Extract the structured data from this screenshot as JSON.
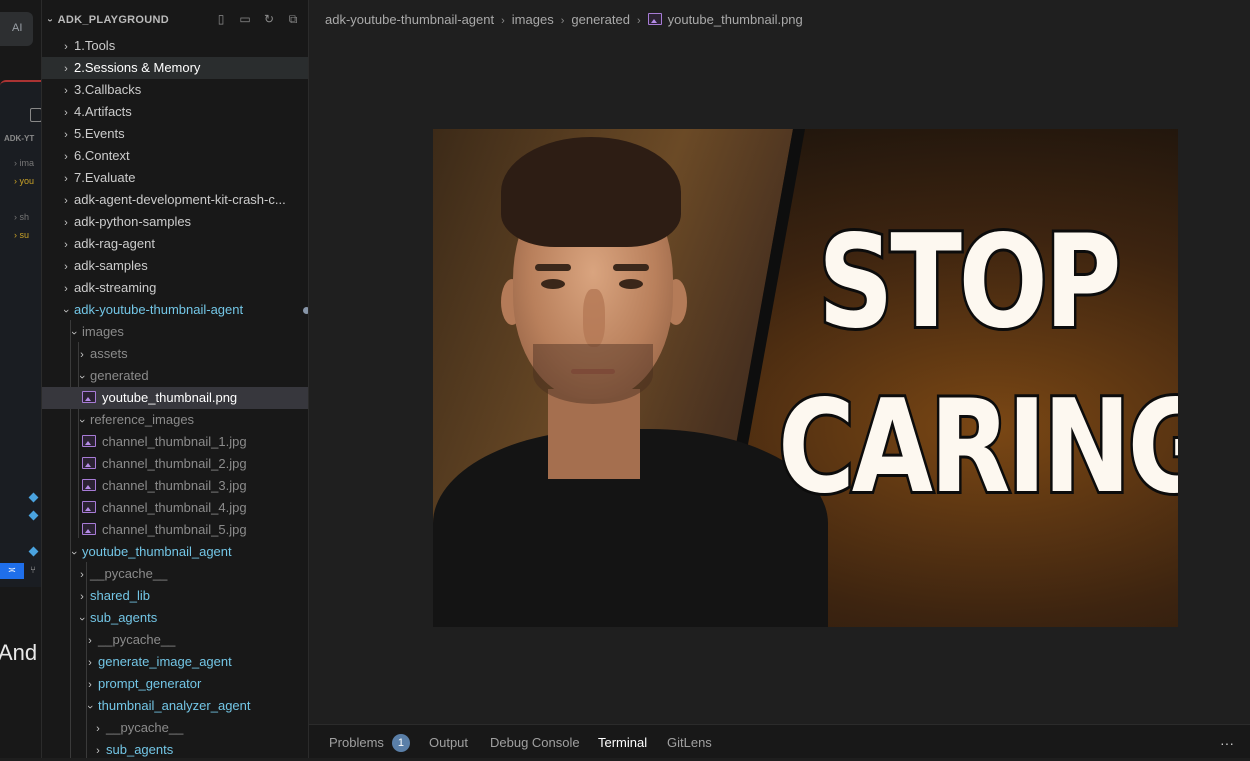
{
  "background_window": {
    "chip_label": "AI",
    "header_label": "ADK-YT",
    "bottom_text": "And I"
  },
  "explorer": {
    "section_title": "ADK_PLAYGROUND",
    "items": [
      {
        "label": "1.Tools"
      },
      {
        "label": "2.Sessions & Memory"
      },
      {
        "label": "3.Callbacks"
      },
      {
        "label": "4.Artifacts"
      },
      {
        "label": "5.Events"
      },
      {
        "label": "6.Context"
      },
      {
        "label": "7.Evaluate"
      },
      {
        "label": "adk-agent-development-kit-crash-c..."
      },
      {
        "label": "adk-python-samples"
      },
      {
        "label": "adk-rag-agent"
      },
      {
        "label": "adk-samples"
      },
      {
        "label": "adk-streaming"
      },
      {
        "label": "adk-youtube-thumbnail-agent"
      },
      {
        "label": "images"
      },
      {
        "label": "assets"
      },
      {
        "label": "generated"
      },
      {
        "label": "youtube_thumbnail.png"
      },
      {
        "label": "reference_images"
      },
      {
        "label": "channel_thumbnail_1.jpg"
      },
      {
        "label": "channel_thumbnail_2.jpg"
      },
      {
        "label": "channel_thumbnail_3.jpg"
      },
      {
        "label": "channel_thumbnail_4.jpg"
      },
      {
        "label": "channel_thumbnail_5.jpg"
      },
      {
        "label": "youtube_thumbnail_agent"
      },
      {
        "label": "__pycache__"
      },
      {
        "label": "shared_lib"
      },
      {
        "label": "sub_agents"
      },
      {
        "label": "__pycache__"
      },
      {
        "label": "generate_image_agent"
      },
      {
        "label": "prompt_generator"
      },
      {
        "label": "thumbnail_analyzer_agent"
      },
      {
        "label": "__pycache__"
      },
      {
        "label": "sub_agents"
      }
    ]
  },
  "breadcrumb": {
    "parts": [
      "adk-youtube-thumbnail-agent",
      "images",
      "generated",
      "youtube_thumbnail.png"
    ]
  },
  "thumbnail": {
    "line1": "STOP",
    "line2": "CARING"
  },
  "panel": {
    "tabs": [
      "Problems",
      "Output",
      "Debug Console",
      "Terminal",
      "GitLens"
    ],
    "problems_count": "1",
    "active_tab": "Terminal",
    "more_label": "···"
  },
  "colors": {
    "modified_folder": "#73c6e6",
    "image_icon": "#a77bd6",
    "badge": "#5a7fa8"
  }
}
